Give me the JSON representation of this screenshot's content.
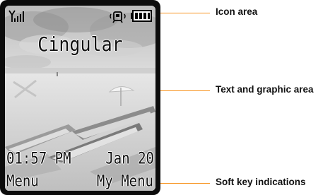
{
  "phone_screen": {
    "carrier": "Cingular",
    "time": "01:57 PM",
    "date": "Jan 20",
    "softkey_left": "Menu",
    "softkey_right": "My Menu",
    "icons": [
      "signal-strength-icon",
      "alarm-icon",
      "battery-icon"
    ]
  },
  "callouts": {
    "icon_area": "Icon area",
    "text_graphic_area": "Text and graphic area",
    "soft_key_indications": "Soft key indications"
  },
  "colors": {
    "callout_line": "#f7931e",
    "bezel": "#0c0c0c"
  }
}
